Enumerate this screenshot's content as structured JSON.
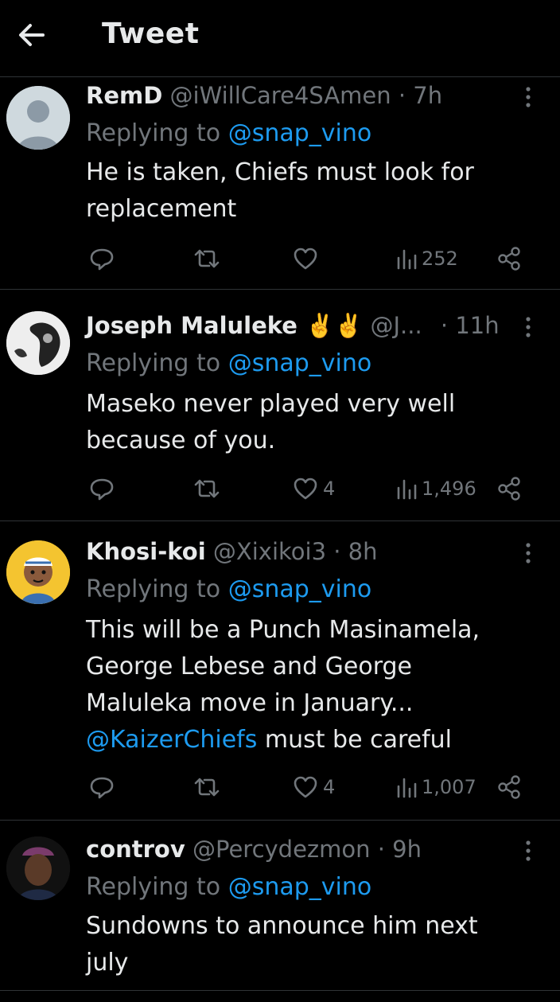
{
  "header": {
    "title": "Tweet",
    "back_icon": "arrow-left-icon"
  },
  "colors": {
    "background": "#000000",
    "text": "#e7e9ea",
    "muted": "#71767b",
    "link": "#1d9bf0",
    "divider": "#2f3336"
  },
  "tweets": [
    {
      "name": "RemD",
      "handle": "@iWillCare4SAmen",
      "time": "· 7h",
      "reply_prefix": "Replying to",
      "reply_to": "@snap_vino",
      "lines": [
        "He is taken, Chiefs must look for",
        "replacement"
      ],
      "likes": "",
      "views": "252"
    },
    {
      "name": "Joseph Maluleke ✌️✌️",
      "handle": "@J...",
      "time": "· 11h",
      "reply_prefix": "Replying to",
      "reply_to": "@snap_vino",
      "lines": [
        "Maseko never played very well",
        "because of you."
      ],
      "likes": "4",
      "views": "1,496"
    },
    {
      "name": "Khosi-koi",
      "handle": "@Xixikoi3",
      "time": "· 8h",
      "reply_prefix": "Replying to",
      "reply_to": "@snap_vino",
      "lines": [
        "This will be a Punch Masinamela,",
        "George Lebese and George",
        "Maluleka move in January..."
      ],
      "mention_line": "@KaizerChiefs",
      "mention_line_rest": " must be careful",
      "likes": "4",
      "views": "1,007"
    },
    {
      "name": "controv",
      "handle": "@Percydezmon",
      "time": "· 9h",
      "reply_prefix": "Replying to",
      "reply_to": "@snap_vino",
      "lines": [
        "Sundowns to announce him next",
        "july"
      ]
    }
  ]
}
